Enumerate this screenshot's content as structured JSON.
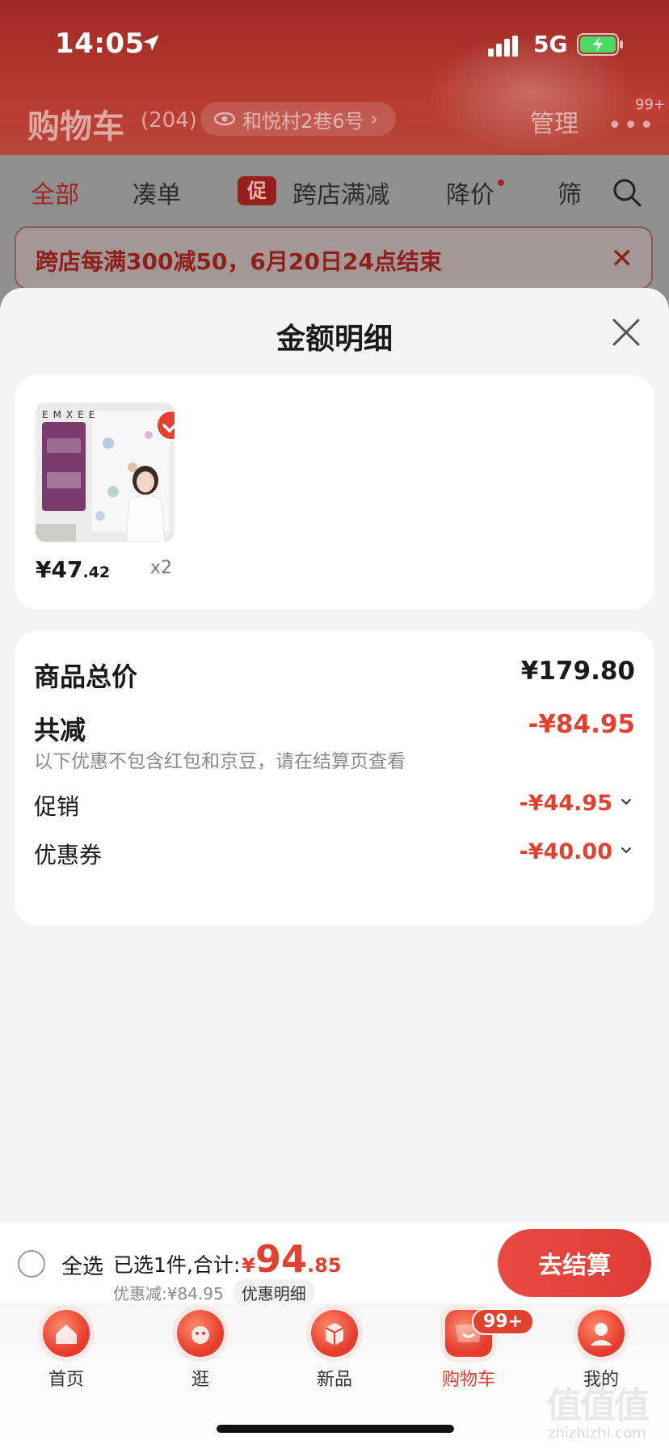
{
  "status_bar": {
    "time": "14:05",
    "network": "5G"
  },
  "header": {
    "title": "购物车",
    "count": "(204)",
    "address": "和悦村2巷6号",
    "manage": "管理",
    "more": "•••",
    "badge": "99+"
  },
  "filter_tabs": [
    {
      "label": "全部",
      "active": true
    },
    {
      "label": "凑单"
    },
    {
      "label": "跨店满减",
      "tag": "促"
    },
    {
      "label": "降价"
    },
    {
      "label": "筛"
    }
  ],
  "banner": {
    "text": "跨店每满300减50，6月20日24点结束"
  },
  "sheet": {
    "title": "金额明细",
    "product": {
      "brand": "EMXEE",
      "price_int": "¥47",
      "price_dec": ".42",
      "quantity": "x2"
    },
    "summary": {
      "total_label": "商品总价",
      "total_value": "¥179.80",
      "reduce_label": "共减",
      "reduce_value": "-¥84.95",
      "note": "以下优惠不包含红包和京豆，请在结算页查看",
      "promo_label": "促销",
      "promo_value": "-¥44.95",
      "coupon_label": "优惠券",
      "coupon_value": "-¥40.00"
    }
  },
  "checkout": {
    "select_all": "全选",
    "selected_text": "已选1件,合计:",
    "currency": "¥",
    "total_int": "94",
    "total_dec": ".85",
    "discount_text": "优惠减:¥84.95",
    "detail_link": "优惠明细",
    "checkout_button": "去结算"
  },
  "tabbar": {
    "items": [
      {
        "label": "首页",
        "icon": "home-icon"
      },
      {
        "label": "逛",
        "icon": "browse-icon"
      },
      {
        "label": "新品",
        "icon": "new-product-icon"
      },
      {
        "label": "购物车",
        "icon": "cart-icon",
        "active": true
      },
      {
        "label": "我的",
        "icon": "profile-icon"
      }
    ],
    "cart_badge": "99+"
  },
  "watermark": {
    "main": "值值值",
    "sub": "zhizhizhi.com"
  },
  "colors": {
    "accent_red": "#e2412f",
    "header_red": "#b73a30",
    "sheet_bg": "#f4f4f4"
  }
}
